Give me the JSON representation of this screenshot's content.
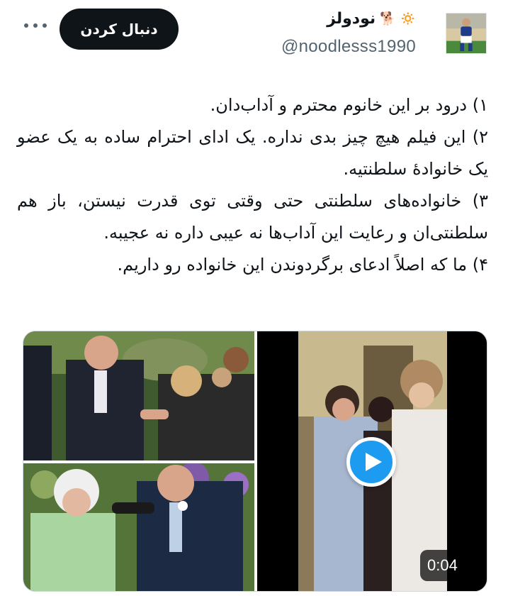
{
  "header": {
    "more_icon": "more-horizontal-icon",
    "follow_label": "دنبال کردن",
    "display_name": "نودولز",
    "handle": "@noodlesss1990",
    "name_emojis": [
      "sun-emoji",
      "dog-emoji"
    ]
  },
  "tweet": {
    "lines": [
      "۱) درود بر این خانوم محترم و آداب‌دان.",
      "۲) این فیلم هیچ چیز بدی نداره. یک ادای احترام ساده به یک عضو یک خانوادهٔ سلطنتیه.",
      "۳) خانواده‌های سلطنتی حتی وقتی توی قدرت نیستن، باز هم سلطنتی‌ان و رعایت این آداب‌ها نه عیبی داره نه عجیبه.",
      "۴) ما که اصلاً ادعای برگردوندن این خانواده رو داریم."
    ]
  },
  "media": {
    "video_duration": "0:04",
    "play_icon": "play-icon"
  },
  "colors": {
    "accent": "#1d9bf0",
    "text": "#0f1419",
    "secondary": "#536471",
    "follow_bg": "#0f1419"
  }
}
